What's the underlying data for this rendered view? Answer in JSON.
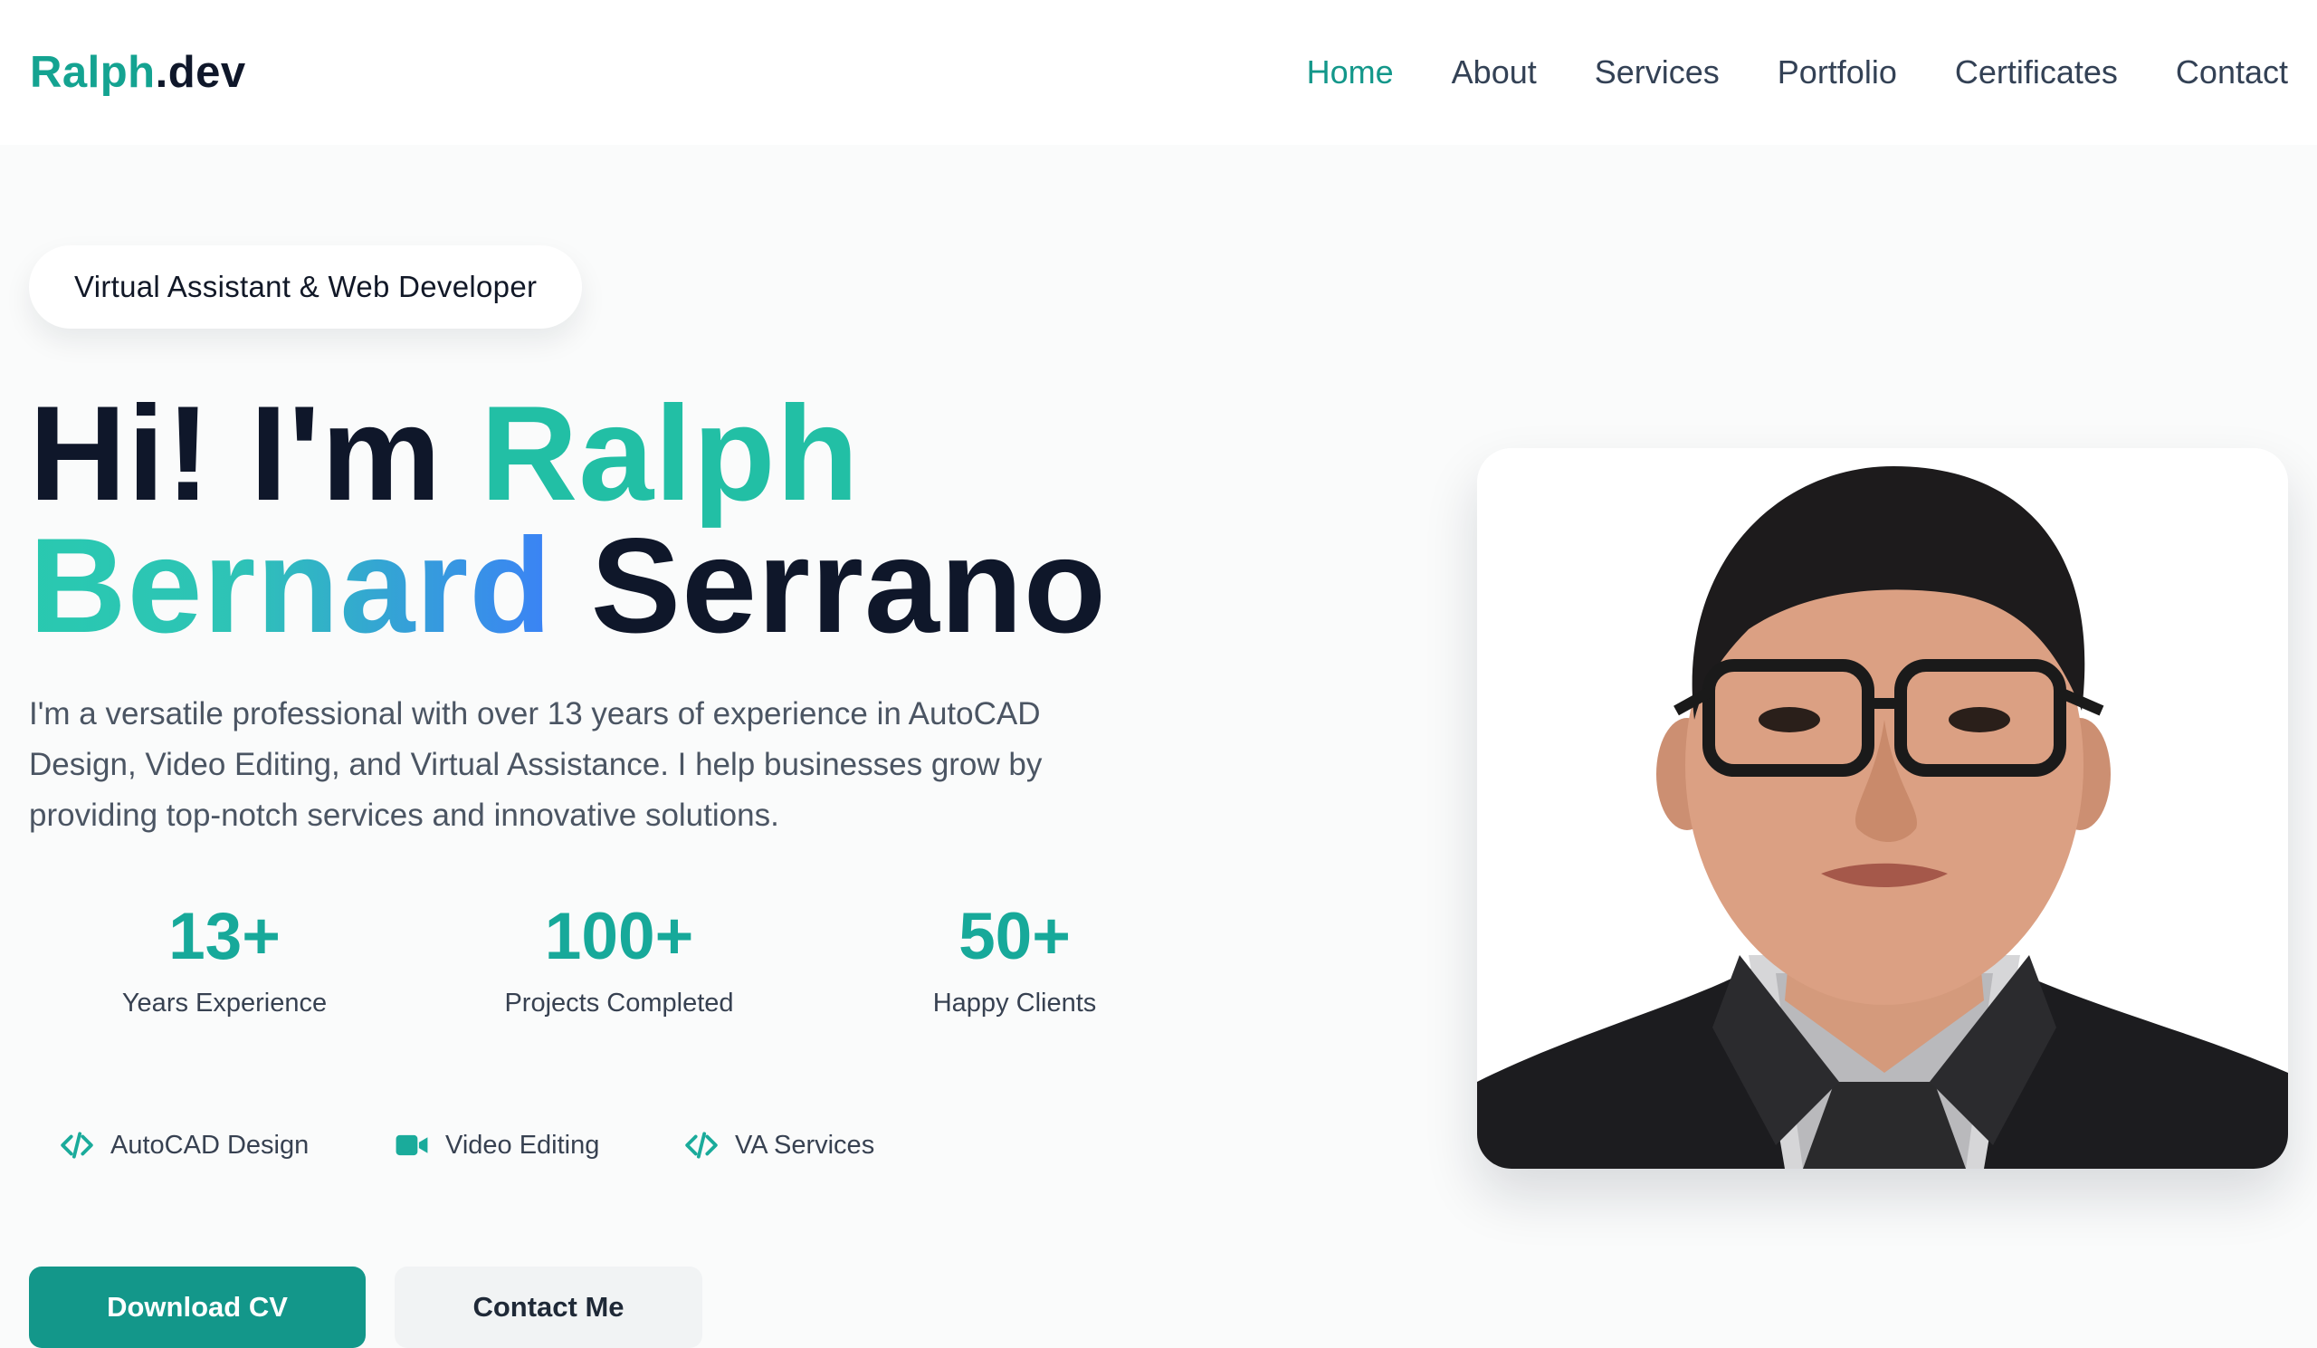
{
  "brand": {
    "name": "Ralph",
    "ext": ".dev"
  },
  "nav": {
    "items": [
      {
        "label": "Home"
      },
      {
        "label": "About"
      },
      {
        "label": "Services"
      },
      {
        "label": "Portfolio"
      },
      {
        "label": "Certificates"
      },
      {
        "label": "Contact"
      }
    ],
    "active": "Home"
  },
  "hero": {
    "badge": "Virtual Assistant & Web Developer",
    "headline": {
      "greeting": "Hi! I'm",
      "first": "Ralph",
      "middle": "Bernard",
      "last": "Serrano"
    },
    "description": "I'm a versatile professional with over 13 years of experience in AutoCAD Design, Video Editing, and Virtual Assistance. I help businesses grow by providing top-notch services and innovative solutions.",
    "stats": [
      {
        "value": "13+",
        "label": "Years Experience"
      },
      {
        "value": "100+",
        "label": "Projects Completed"
      },
      {
        "value": "50+",
        "label": "Happy Clients"
      }
    ],
    "skills": [
      {
        "icon": "code-icon",
        "label": "AutoCAD Design"
      },
      {
        "icon": "video-camera-icon",
        "label": "Video Editing"
      },
      {
        "icon": "code-icon",
        "label": "VA Services"
      }
    ],
    "buttons": {
      "primary": "Download CV",
      "secondary": "Contact Me"
    }
  },
  "colors": {
    "accent": "#13978a",
    "accent_light": "#22bfa5",
    "gradient_end": "#3b82f6",
    "text_dark": "#0f172a",
    "text_muted": "#4b5563"
  }
}
